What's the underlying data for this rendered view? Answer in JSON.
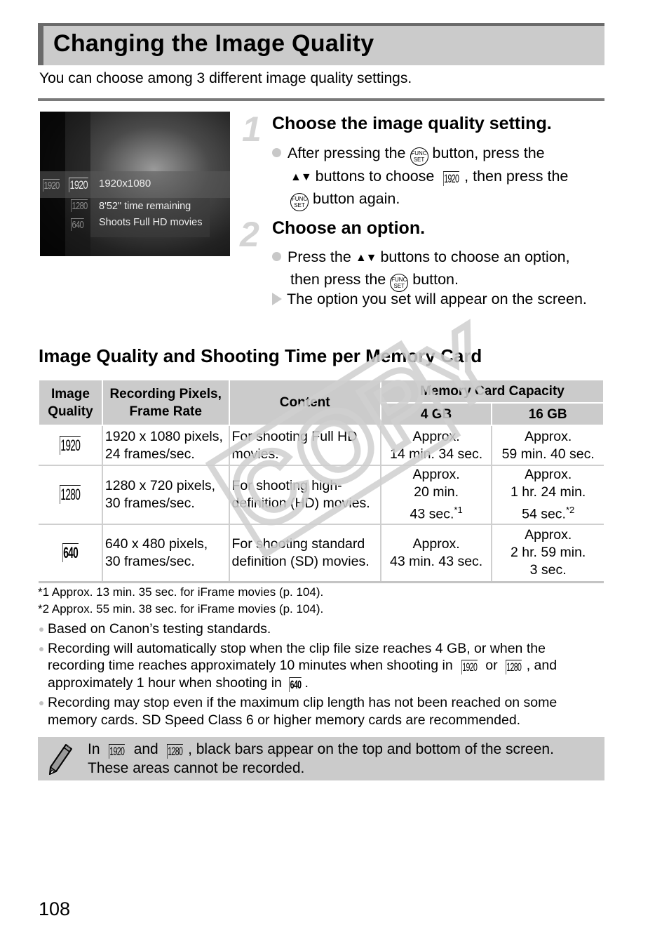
{
  "header": {
    "title": "Changing the Image Quality",
    "intro": "You can choose among 3 different image quality settings."
  },
  "screen": {
    "left_icon": "1920",
    "selected_icon": "1920",
    "other_icons": [
      "1280",
      "640"
    ],
    "resolution": "1920x1080",
    "time_remaining": "8'52\" time remaining",
    "description": "Shoots Full HD movies"
  },
  "icons": {
    "func_set_top": "FUNC",
    "func_set_bottom": "SET",
    "arrows": "▲▼",
    "q1920": "1920",
    "q1280": "1280",
    "q640": "640"
  },
  "steps": [
    {
      "number": "1",
      "title": "Choose the image quality setting.",
      "text_a": "After pressing the",
      "text_b": "button, press the",
      "text_c": "buttons to choose",
      "text_d": ", then press the",
      "text_e": "button again."
    },
    {
      "number": "2",
      "title": "Choose an option.",
      "text_a": "Press the",
      "text_b": "buttons to choose an option, then press the",
      "text_c": "button.",
      "result": "The option you set will appear on the screen."
    }
  ],
  "section": {
    "heading": "Image Quality and Shooting Time per Memory Card"
  },
  "table": {
    "headers": {
      "quality": "Image Quality",
      "quality_l1": "Image",
      "quality_l2": "Quality",
      "pixels_l1": "Recording Pixels,",
      "pixels_l2": "Frame Rate",
      "content": "Content",
      "capacity": "Memory Card Capacity",
      "gb4": "4 GB",
      "gb16": "16 GB"
    },
    "rows": [
      {
        "icon": "1920",
        "pixels_l1": "1920 x 1080 pixels,",
        "pixels_l2": "24 frames/sec.",
        "content_l1": "For shooting Full HD",
        "content_l2": "movies.",
        "gb4_l1": "Approx.",
        "gb4_l2": "14 min. 34 sec.",
        "gb16_l1": "Approx.",
        "gb16_l2": "59 min. 40 sec."
      },
      {
        "icon": "1280",
        "pixels_l1": "1280 x 720 pixels,",
        "pixels_l2": "30 frames/sec.",
        "content_l1": "For shooting high-",
        "content_l2": "definition (HD) movies.",
        "gb4_l1": "Approx.",
        "gb4_l2": "20 min.",
        "gb4_l3": "43 sec.",
        "gb4_note": "*1",
        "gb16_l1": "Approx.",
        "gb16_l2": "1 hr. 24 min.",
        "gb16_l3": "54 sec.",
        "gb16_note": "*2"
      },
      {
        "icon": "640",
        "pixels_l1": "640 x 480 pixels,",
        "pixels_l2": "30 frames/sec.",
        "content_l1": "For shooting standard",
        "content_l2": "definition (SD) movies.",
        "gb4_l1": "Approx.",
        "gb4_l2": "43 min. 43 sec.",
        "gb16_l1": "Approx.",
        "gb16_l2": "2 hr. 59 min.",
        "gb16_l3": "3 sec."
      }
    ]
  },
  "watermark": "COPY",
  "footnotes": [
    "*1 Approx. 13 min. 35 sec. for iFrame movies (p. 104).",
    "*2 Approx. 55 min. 38 sec. for iFrame movies (p. 104)."
  ],
  "notes": {
    "n1": "Based on Canon’s testing standards.",
    "n2_a": "Recording will automatically stop when the clip file size reaches 4 GB, or when the recording time reaches approximately 10 minutes when shooting in",
    "n2_or": "or",
    "n2_b": ", and approximately 1 hour when shooting in",
    "n2_end": ".",
    "n3": "Recording may stop even if the maximum clip length has not been reached on some memory cards. SD Speed Class 6 or higher memory cards are recommended."
  },
  "memo": {
    "in": "In",
    "and": "and",
    "text_a": ", black bars appear on the top and bottom of the screen.",
    "text_b": "These areas cannot be recorded."
  },
  "page_number": "108"
}
